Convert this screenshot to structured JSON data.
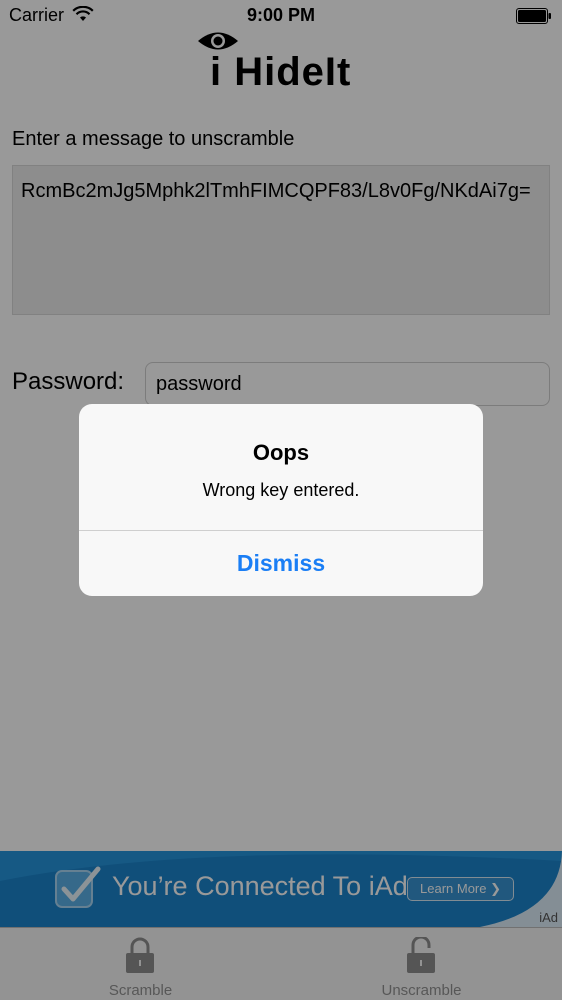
{
  "status_bar": {
    "carrier": "Carrier",
    "time": "9:00 PM"
  },
  "app": {
    "logo_text": "i HideIt"
  },
  "form": {
    "instruction": "Enter a message to unscramble",
    "message_value": "RcmBc2mJg5Mphk2lTmhFIMCQPF83/L8v0Fg/NKdAi7g=",
    "password_label": "Password:",
    "password_value": "password"
  },
  "ad": {
    "text": "You’re Connected To iAd",
    "learn_more": "Learn More ❯",
    "tag": "iAd",
    "accent": "#1a78c4"
  },
  "tabs": [
    {
      "label": "Scramble",
      "icon": "lock-closed-icon"
    },
    {
      "label": "Unscramble",
      "icon": "lock-open-icon"
    }
  ],
  "alert": {
    "title": "Oops",
    "message": "Wrong key entered.",
    "button": "Dismiss",
    "button_color": "#1a7ef5"
  }
}
